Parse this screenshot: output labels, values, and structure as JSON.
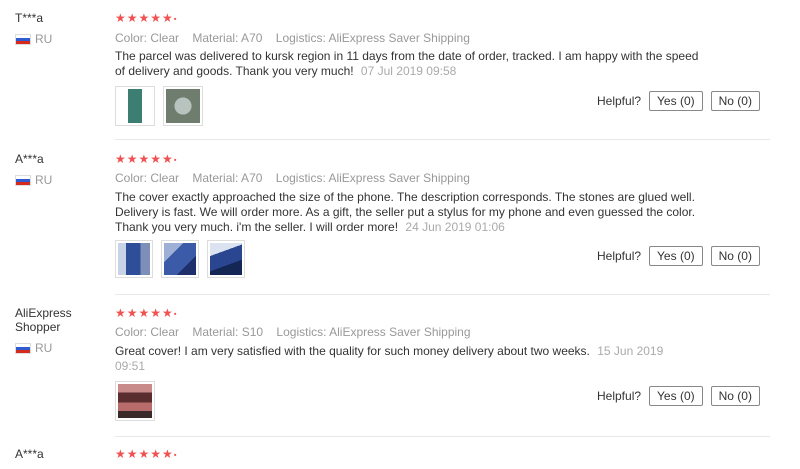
{
  "reviews": [
    {
      "user": "T***a",
      "country": "RU",
      "stars": "★★★★★",
      "color": "Color: Clear",
      "material": "Material: A70",
      "logistics": "Logistics: AliExpress Saver Shipping",
      "text": "The parcel was delivered to kursk region in 11 days from the date of order, tracked. I am happy with the speed of delivery and goods. Thank you very much!",
      "date": "07 Jul 2019 09:58",
      "helpful_label": "Helpful?",
      "yes_label": "Yes (0)",
      "no_label": "No (0)"
    },
    {
      "user": "A***a",
      "country": "RU",
      "stars": "★★★★★",
      "color": "Color: Clear",
      "material": "Material: A70",
      "logistics": "Logistics: AliExpress Saver Shipping",
      "text": "The cover exactly approached the size of the phone. The description corresponds. The stones are glued well. Delivery is fast. We will order more. As a gift, the seller put a stylus for my phone and even guessed the color. Thank you very much. i'm the seller. I will order more!",
      "date": "24 Jun 2019 01:06",
      "helpful_label": "Helpful?",
      "yes_label": "Yes (0)",
      "no_label": "No (0)"
    },
    {
      "user": "AliExpress Shopper",
      "country": "RU",
      "stars": "★★★★★",
      "color": "Color: Clear",
      "material": "Material: S10",
      "logistics": "Logistics: AliExpress Saver Shipping",
      "text": "Great cover! I am very satisfied with the quality for such money delivery about two weeks.",
      "date": "15 Jun 2019 09:51",
      "helpful_label": "Helpful?",
      "yes_label": "Yes (0)",
      "no_label": "No (0)"
    },
    {
      "user": "A***a",
      "stars": "★★★★★"
    }
  ]
}
